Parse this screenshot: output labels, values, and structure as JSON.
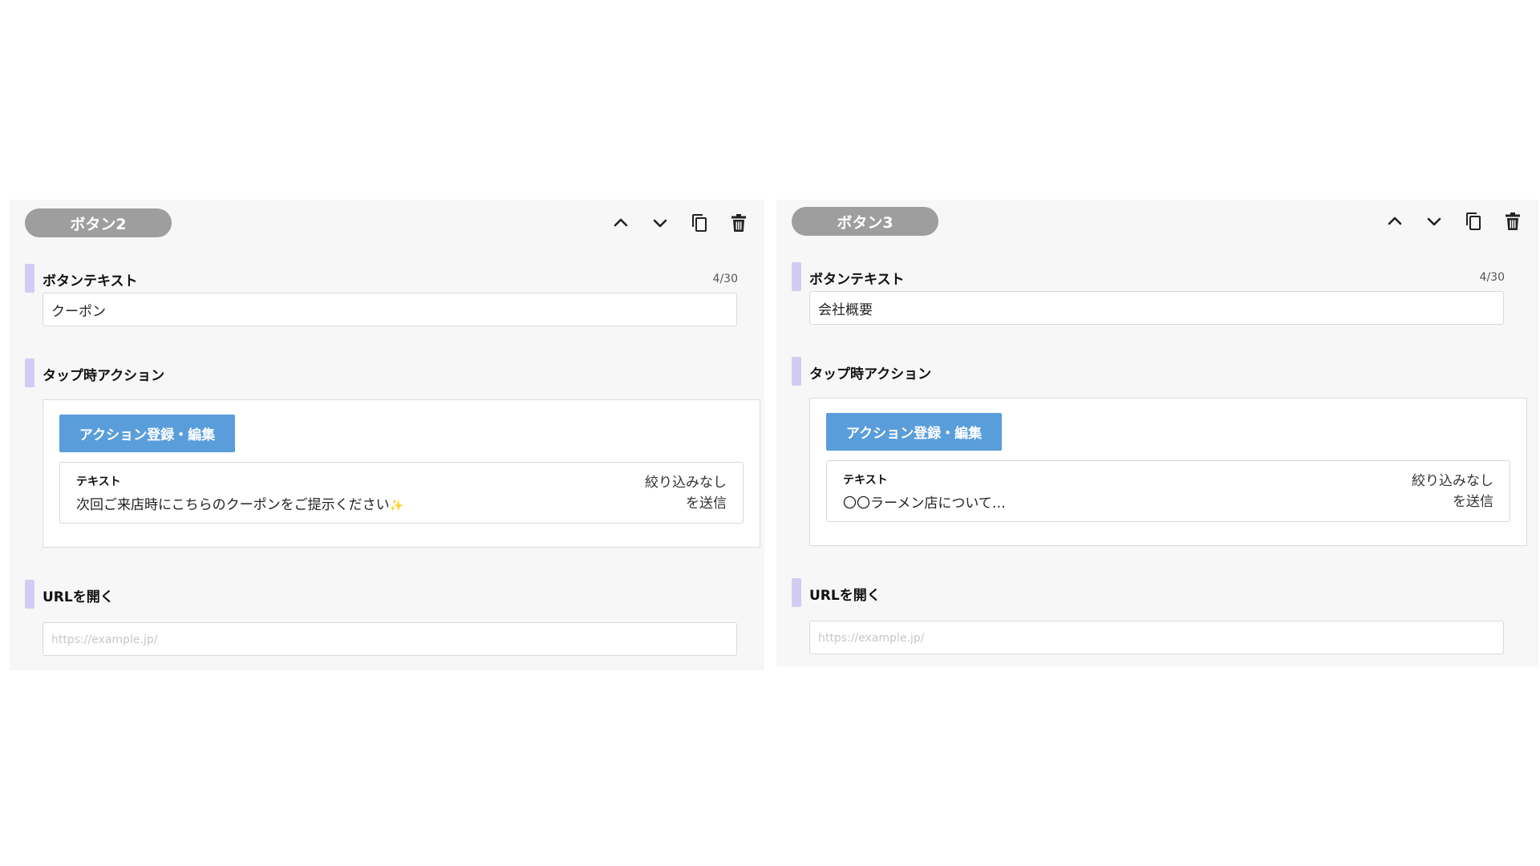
{
  "panels": [
    {
      "title": "ボタン2",
      "button_text_label": "ボタンテキスト",
      "char_count": "4/30",
      "button_text_value": "クーポン",
      "tap_action_label": "タップ時アクション",
      "action_button_label": "アクション登録・編集",
      "action": {
        "type": "テキスト",
        "message": "次回ご来店時にこちらのクーポンをご提示ください",
        "sparkle": "✨",
        "filter_line1": "絞り込みなし",
        "filter_line2": "を送信"
      },
      "url_label": "URLを開く",
      "url_placeholder": "https://example.jp/"
    },
    {
      "title": "ボタン3",
      "button_text_label": "ボタンテキスト",
      "char_count": "4/30",
      "button_text_value": "会社概要",
      "tap_action_label": "タップ時アクション",
      "action_button_label": "アクション登録・編集",
      "action": {
        "type": "テキスト",
        "message": "〇〇ラーメン店について…",
        "filter_line1": "絞り込みなし",
        "filter_line2": "を送信"
      },
      "url_label": "URLを開く",
      "url_placeholder": "https://example.jp/"
    }
  ],
  "toolbar_icons": [
    "chevron-up-icon",
    "chevron-down-icon",
    "copy-icon",
    "trash-icon"
  ],
  "colors": {
    "panel_bg": "#f7f7f7",
    "pill_bg": "#9e9e9e",
    "accent_bar": "#d4cbf3",
    "action_button": "#5a9ddb"
  }
}
